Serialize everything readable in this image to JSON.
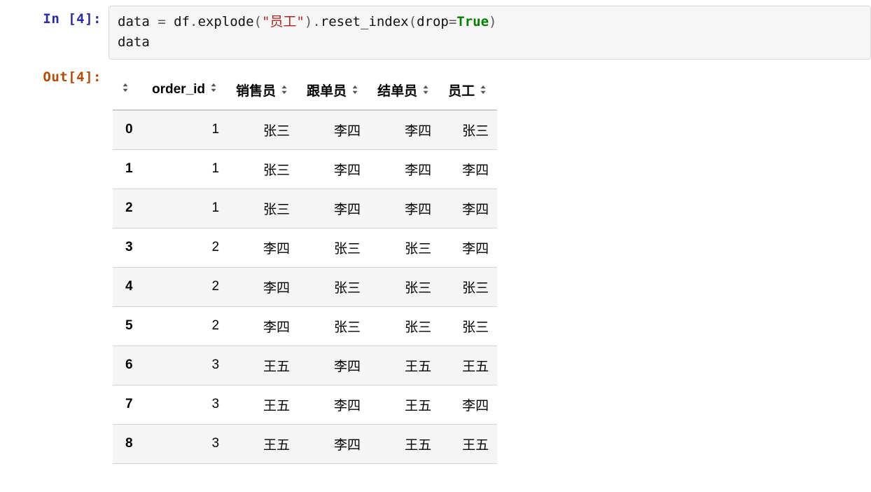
{
  "input": {
    "prompt": "In [4]:",
    "code_tokens": [
      {
        "t": "data ",
        "c": "tok-name"
      },
      {
        "t": "=",
        "c": "tok-op"
      },
      {
        "t": " df",
        "c": "tok-name"
      },
      {
        "t": ".",
        "c": "tok-op"
      },
      {
        "t": "explode",
        "c": "tok-name"
      },
      {
        "t": "(",
        "c": "tok-op"
      },
      {
        "t": "\"员工\"",
        "c": "tok-str"
      },
      {
        "t": ")",
        "c": "tok-op"
      },
      {
        "t": ".",
        "c": "tok-op"
      },
      {
        "t": "reset_index",
        "c": "tok-name"
      },
      {
        "t": "(",
        "c": "tok-op"
      },
      {
        "t": "drop",
        "c": "tok-name"
      },
      {
        "t": "=",
        "c": "tok-op"
      },
      {
        "t": "True",
        "c": "tok-kw"
      },
      {
        "t": ")",
        "c": "tok-op"
      },
      {
        "t": "\n",
        "c": "tok-name"
      },
      {
        "t": "data",
        "c": "tok-name"
      }
    ]
  },
  "output": {
    "prompt": "Out[4]:",
    "columns": [
      "",
      "order_id",
      "销售员",
      "跟单员",
      "结单员",
      "员工"
    ],
    "rows": [
      {
        "idx": "0",
        "cells": [
          "1",
          "张三",
          "李四",
          "李四",
          "张三"
        ]
      },
      {
        "idx": "1",
        "cells": [
          "1",
          "张三",
          "李四",
          "李四",
          "李四"
        ]
      },
      {
        "idx": "2",
        "cells": [
          "1",
          "张三",
          "李四",
          "李四",
          "李四"
        ]
      },
      {
        "idx": "3",
        "cells": [
          "2",
          "李四",
          "张三",
          "张三",
          "李四"
        ]
      },
      {
        "idx": "4",
        "cells": [
          "2",
          "李四",
          "张三",
          "张三",
          "张三"
        ]
      },
      {
        "idx": "5",
        "cells": [
          "2",
          "李四",
          "张三",
          "张三",
          "张三"
        ]
      },
      {
        "idx": "6",
        "cells": [
          "3",
          "王五",
          "李四",
          "王五",
          "王五"
        ]
      },
      {
        "idx": "7",
        "cells": [
          "3",
          "王五",
          "李四",
          "王五",
          "李四"
        ]
      },
      {
        "idx": "8",
        "cells": [
          "3",
          "王五",
          "李四",
          "王五",
          "王五"
        ]
      }
    ]
  }
}
